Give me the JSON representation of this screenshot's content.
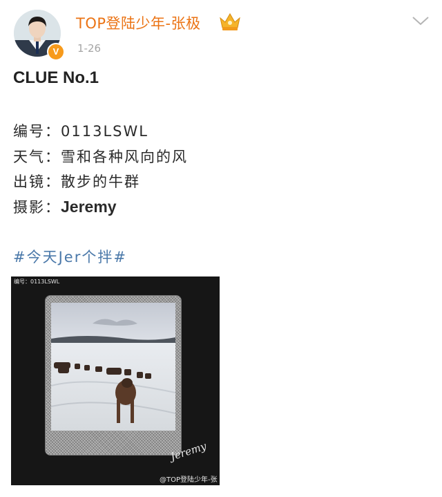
{
  "post": {
    "username": "TOP登陆少年-张极",
    "timestamp": "1-26",
    "verified_badge": "V",
    "title": "CLUE No.1",
    "info": [
      {
        "label": "编号：",
        "value": "0113LSWL"
      },
      {
        "label": "天气：",
        "value": "雪和各种风向的风"
      },
      {
        "label": "出镜：",
        "value": "散步的牛群"
      },
      {
        "label": "摄影：",
        "value": "Jeremy"
      }
    ],
    "hashtag": "#今天Jer个拌#"
  },
  "image": {
    "code_text": "编号：0113LSWL",
    "signature": "Jeremy",
    "watermark": "@TOP登陆少年-张极"
  },
  "icons": {
    "crown": "crown-icon",
    "more": "chevron-down-icon",
    "verified": "verified-badge"
  },
  "colors": {
    "username": "#eb7314",
    "hashtag": "#4a78a9",
    "timestamp": "#a5a5a5",
    "verified": "#f79a1b"
  }
}
